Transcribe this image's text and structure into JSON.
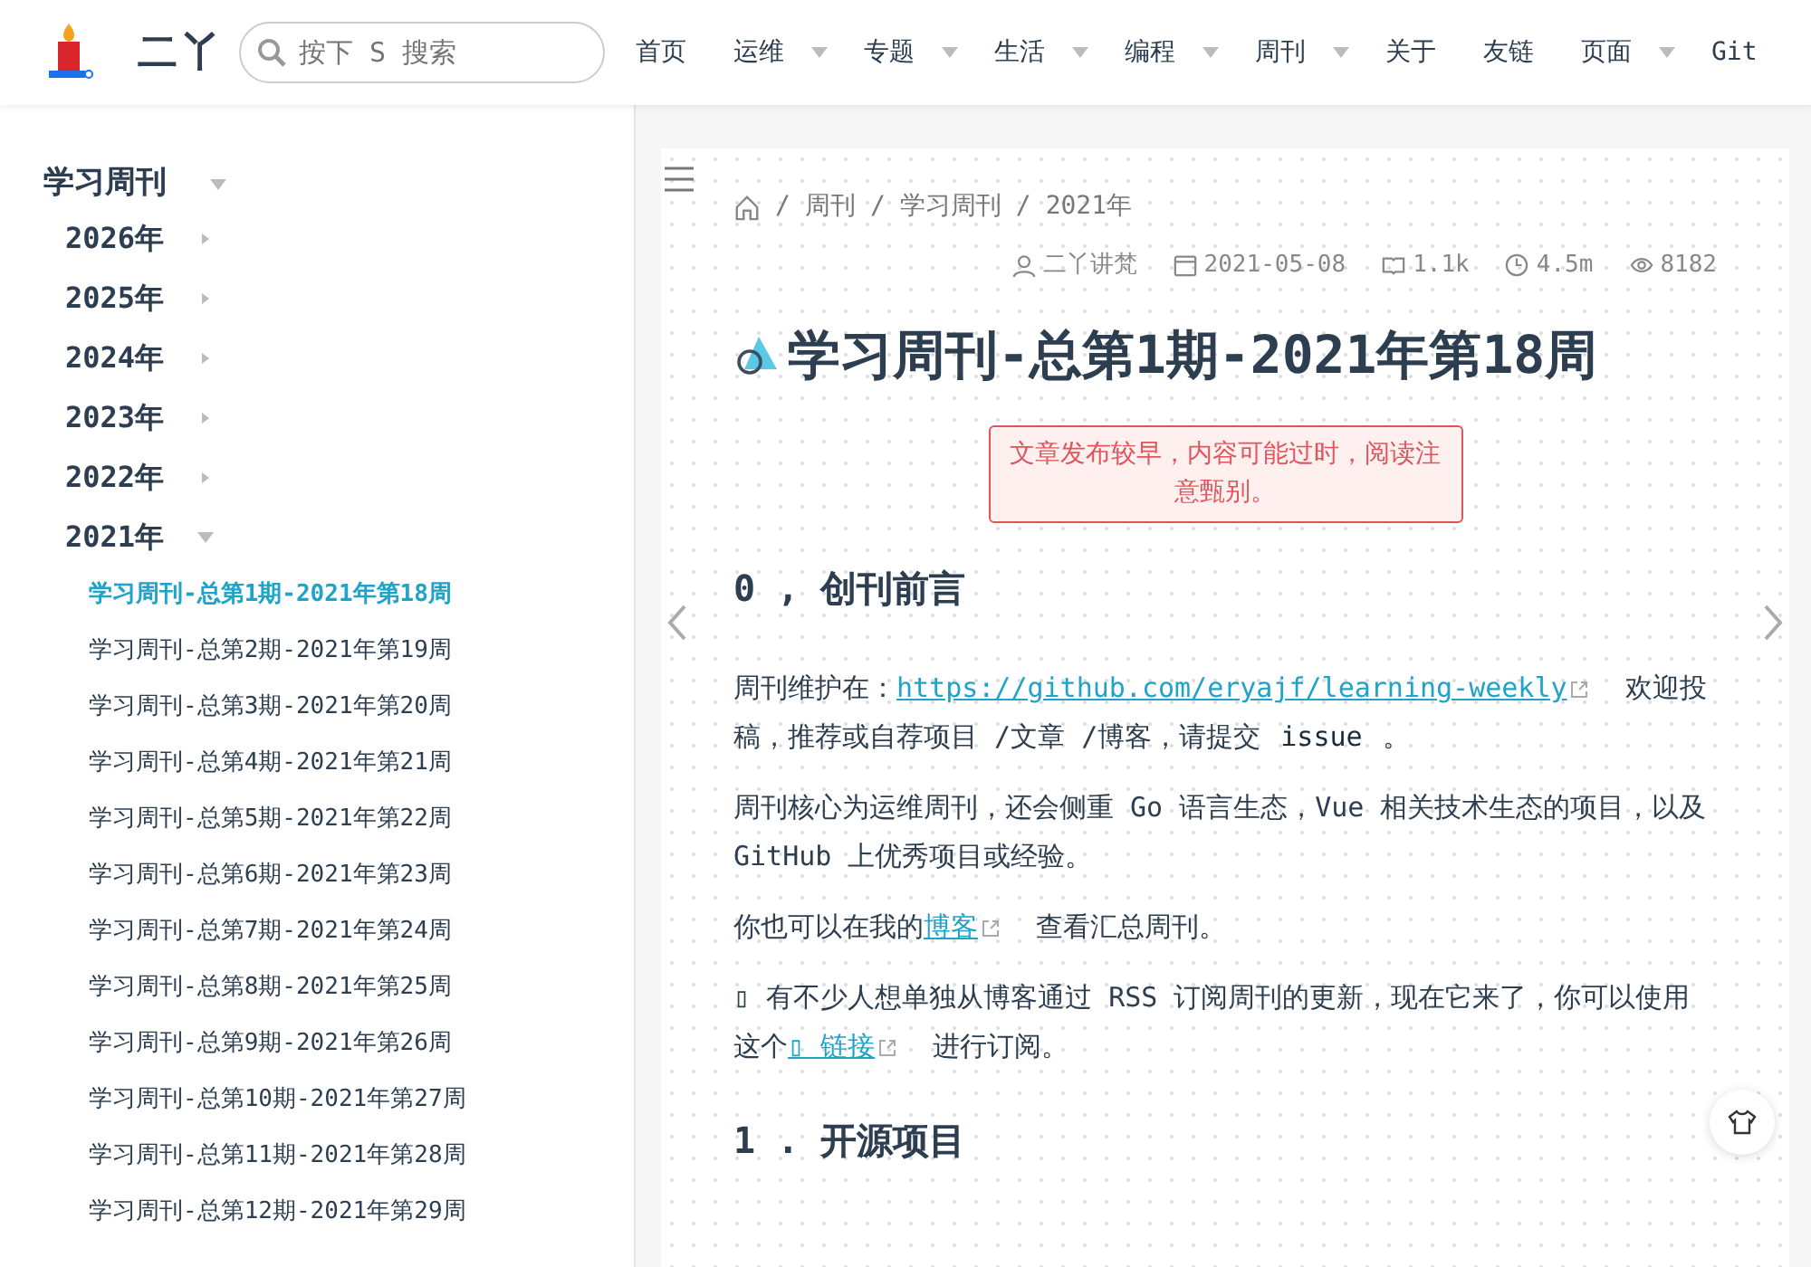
{
  "header": {
    "logo_text": "二丫",
    "search": {
      "placeholder": "按下 S 搜索"
    },
    "nav": [
      {
        "label": "首页",
        "dropdown": false
      },
      {
        "label": "运维",
        "dropdown": true
      },
      {
        "label": "专题",
        "dropdown": true
      },
      {
        "label": "生活",
        "dropdown": true
      },
      {
        "label": "编程",
        "dropdown": true
      },
      {
        "label": "周刊",
        "dropdown": true
      },
      {
        "label": "关于",
        "dropdown": false
      },
      {
        "label": "友链",
        "dropdown": false
      },
      {
        "label": "页面",
        "dropdown": true
      },
      {
        "label": "Git",
        "dropdown": false
      }
    ]
  },
  "sidebar": {
    "title": "学习周刊",
    "expanded": true,
    "years": [
      {
        "label": "2026年",
        "expanded": false
      },
      {
        "label": "2025年",
        "expanded": false
      },
      {
        "label": "2024年",
        "expanded": false
      },
      {
        "label": "2023年",
        "expanded": false
      },
      {
        "label": "2022年",
        "expanded": false
      },
      {
        "label": "2021年",
        "expanded": true,
        "children": [
          {
            "label": "学习周刊-总第1期-2021年第18周",
            "selected": true
          },
          {
            "label": "学习周刊-总第2期-2021年第19周",
            "selected": false
          },
          {
            "label": "学习周刊-总第3期-2021年第20周",
            "selected": false
          },
          {
            "label": "学习周刊-总第4期-2021年第21周",
            "selected": false
          },
          {
            "label": "学习周刊-总第5期-2021年第22周",
            "selected": false
          },
          {
            "label": "学习周刊-总第6期-2021年第23周",
            "selected": false
          },
          {
            "label": "学习周刊-总第7期-2021年第24周",
            "selected": false
          },
          {
            "label": "学习周刊-总第8期-2021年第25周",
            "selected": false
          },
          {
            "label": "学习周刊-总第9期-2021年第26周",
            "selected": false
          },
          {
            "label": "学习周刊-总第10期-2021年第27周",
            "selected": false
          },
          {
            "label": "学习周刊-总第11期-2021年第28周",
            "selected": false
          },
          {
            "label": "学习周刊-总第12期-2021年第29周",
            "selected": false
          }
        ]
      }
    ]
  },
  "breadcrumb": [
    {
      "separator": "/",
      "label": "周刊"
    },
    {
      "separator": "/",
      "label": "学习周刊"
    },
    {
      "separator": "/",
      "label": "2021年"
    }
  ],
  "meta": [
    {
      "kind": "author",
      "text": "二丫讲梵"
    },
    {
      "kind": "date",
      "text": "2021-05-08"
    },
    {
      "kind": "words",
      "text": "1.1k"
    },
    {
      "kind": "time",
      "text": "4.5m"
    },
    {
      "kind": "views",
      "text": "8182"
    }
  ],
  "title": "学习周刊-总第1期-2021年第18周",
  "warning": "文章发布较早，内容可能过时，阅读注意甄别。",
  "sections": [
    {
      "heading": "0 , 创刊前言",
      "paragraphs": [
        [
          {
            "kind": "text",
            "text": "周刊维护在："
          },
          {
            "kind": "link",
            "text": "https://github.com/eryajf/learning-weekly"
          },
          {
            "kind": "text",
            "text": "欢迎投稿，推荐或自荐项目 /文章 /博客，请提交 "
          },
          {
            "kind": "code",
            "text": "issue"
          },
          {
            "kind": "text",
            "text": " 。"
          }
        ],
        [
          {
            "kind": "text",
            "text": "周刊核心为运维周刊，还会侧重 Go 语言生态，Vue 相关技术生态的项目，以及 GitHub 上优秀项目或经验。"
          }
        ],
        [
          {
            "kind": "text",
            "text": "你也可以在我的"
          },
          {
            "kind": "link",
            "text": "博客"
          },
          {
            "kind": "text",
            "text": "查看汇总周刊。"
          }
        ],
        [
          {
            "kind": "text",
            "text": "▯ 有不少人想单独从博客通过 RSS 订阅周刊的更新，现在它来了，你可以使用这个"
          },
          {
            "kind": "link",
            "text": "▯ 链接"
          },
          {
            "kind": "text",
            "text": "进行订阅。"
          }
        ]
      ]
    },
    {
      "heading": "1 . 开源项目"
    }
  ]
}
